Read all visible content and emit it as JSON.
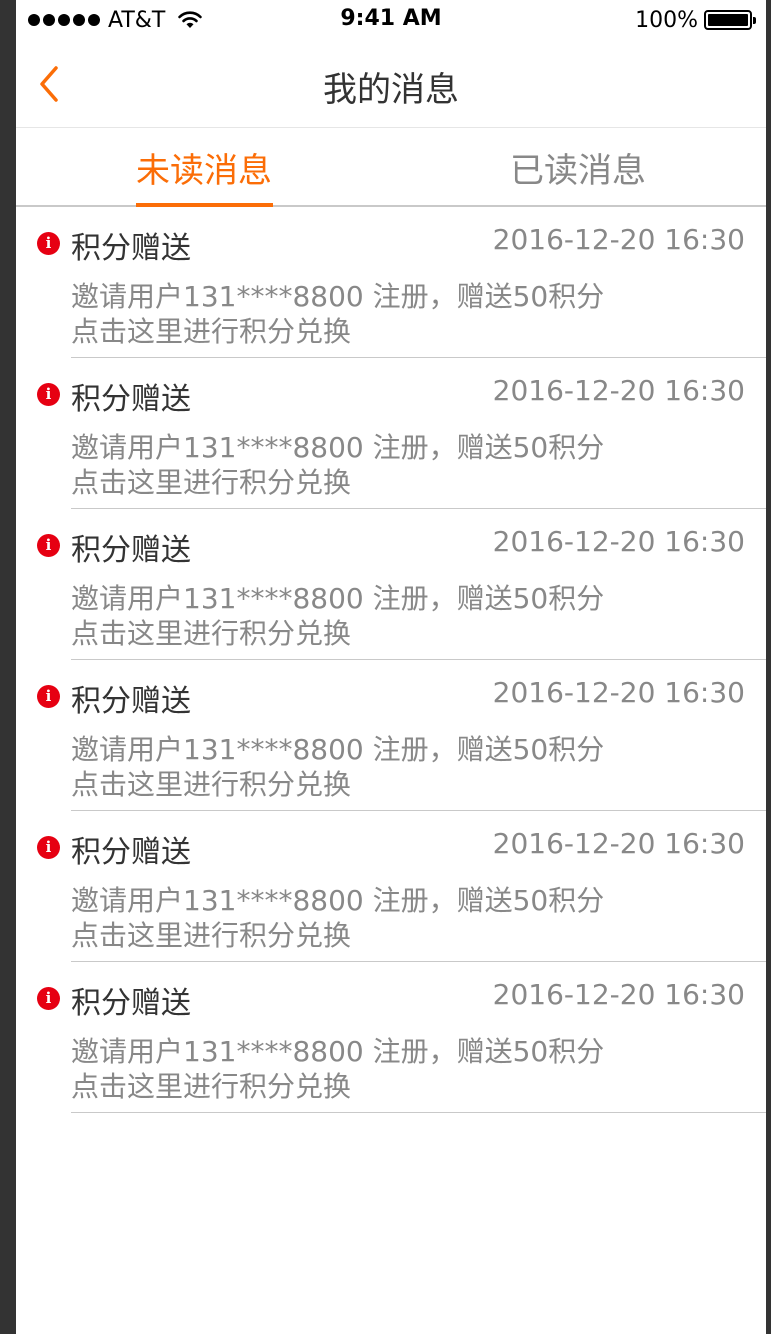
{
  "status_bar": {
    "carrier": "AT&T",
    "time": "9:41 AM",
    "battery": "100%",
    "battery_level": 1.0
  },
  "nav": {
    "title": "我的消息",
    "back_icon": "chevron-left-icon",
    "accent": "#fb6d07"
  },
  "tabs": [
    {
      "label": "未读消息",
      "active": true,
      "color": "#fb6d07"
    },
    {
      "label": "已读消息",
      "active": false,
      "color": "#888888"
    }
  ],
  "messages": [
    {
      "title": "积分赠送",
      "time": "2016-12-20 16:30",
      "line1": "邀请用户131****8800 注册，赠送50积分",
      "line2": "点击这里进行积分兑换"
    },
    {
      "title": "积分赠送",
      "time": "2016-12-20 16:30",
      "line1": "邀请用户131****8800 注册，赠送50积分",
      "line2": "点击这里进行积分兑换"
    },
    {
      "title": "积分赠送",
      "time": "2016-12-20 16:30",
      "line1": "邀请用户131****8800 注册，赠送50积分",
      "line2": "点击这里进行积分兑换"
    },
    {
      "title": "积分赠送",
      "time": "2016-12-20 16:30",
      "line1": "邀请用户131****8800 注册，赠送50积分",
      "line2": "点击这里进行积分兑换"
    },
    {
      "title": "积分赠送",
      "time": "2016-12-20 16:30",
      "line1": "邀请用户131****8800 注册，赠送50积分",
      "line2": "点击这里进行积分兑换"
    },
    {
      "title": "积分赠送",
      "time": "2016-12-20 16:30",
      "line1": "邀请用户131****8800 注册，赠送50积分",
      "line2": "点击这里进行积分兑换"
    }
  ],
  "colors": {
    "title_text": "#333333",
    "secondary_text": "#888888",
    "divider": "#c9c9c9",
    "background": "#ffffff",
    "unread_icon": "#e60012"
  },
  "icons": {
    "unread": "info-icon",
    "signal": "signal-dots-icon",
    "wifi": "wifi-icon",
    "battery": "battery-icon"
  }
}
